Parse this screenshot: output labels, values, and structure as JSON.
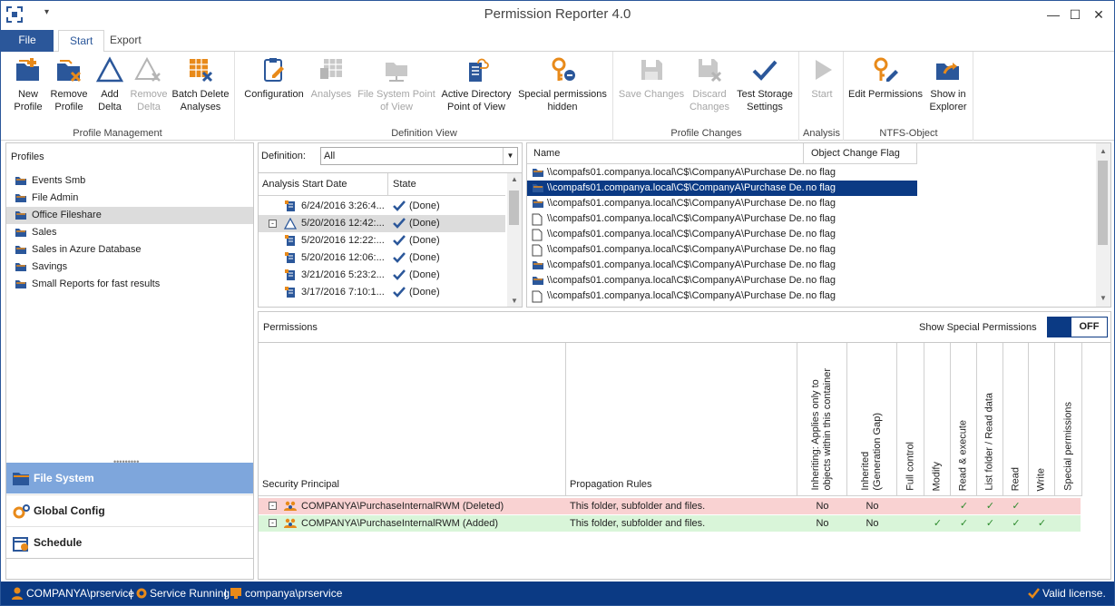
{
  "window": {
    "title": "Permission Reporter 4.0"
  },
  "colors": {
    "accent": "#2b579a",
    "selection": "#0b3a84",
    "nav_active": "#7ea6dc",
    "deleted_row": "#f9d2d2",
    "added_row": "#d9f5d9",
    "check": "#2e8b2e"
  },
  "ribbon_tabs": {
    "file": "File",
    "start": "Start",
    "export": "Export"
  },
  "ribbon": {
    "profile_management": {
      "label": "Profile Management",
      "new_profile": [
        "New",
        "Profile"
      ],
      "remove_profile": [
        "Remove",
        "Profile"
      ],
      "add_delta": [
        "Add",
        "Delta"
      ],
      "remove_delta": [
        "Remove",
        "Delta"
      ],
      "batch_delete": [
        "Batch Delete",
        "Analyses"
      ]
    },
    "definition_view": {
      "label": "Definition View",
      "configuration": "Configuration",
      "analyses": "Analyses",
      "file_system_pov": [
        "File System Point",
        "of View"
      ],
      "active_directory_pov": [
        "Active Directory",
        "Point of View"
      ],
      "special_permissions": [
        "Special permissions",
        "hidden"
      ]
    },
    "profile_changes": {
      "label": "Profile Changes",
      "save_changes": "Save Changes",
      "discard_changes": [
        "Discard",
        "Changes"
      ],
      "test_storage": [
        "Test Storage",
        "Settings"
      ]
    },
    "analysis": {
      "label": "Analysis",
      "start": "Start"
    },
    "ntfs_object": {
      "label": "NTFS-Object",
      "edit_permissions": "Edit Permissions",
      "show_in_explorer": [
        "Show in",
        "Explorer"
      ]
    }
  },
  "profiles": {
    "title": "Profiles",
    "items": [
      "Events Smb",
      "File Admin",
      "Office Fileshare",
      "Sales",
      "Sales in Azure Database",
      "Savings",
      "Small Reports for fast results"
    ],
    "selected": "Office Fileshare"
  },
  "nav": {
    "file_system": "File System",
    "global_config": "Global Config",
    "schedule": "Schedule"
  },
  "definition": {
    "label": "Definition:",
    "value": "All"
  },
  "analyses_grid": {
    "col_date": "Analysis Start Date",
    "col_state": "State",
    "rows": [
      {
        "date": "6/24/2016 3:26:4...",
        "state": "(Done)"
      },
      {
        "date": "5/20/2016 12:42:...",
        "state": "(Done)"
      },
      {
        "date": "5/20/2016 12:22:...",
        "state": "(Done)"
      },
      {
        "date": "5/20/2016 12:06:...",
        "state": "(Done)"
      },
      {
        "date": "3/21/2016 5:23:2...",
        "state": "(Done)"
      },
      {
        "date": "3/17/2016 7:10:1...",
        "state": "(Done)"
      }
    ]
  },
  "objects_grid": {
    "col_name": "Name",
    "col_flag": "Object Change Flag",
    "rows": [
      {
        "name": "\\\\compafs01.companya.local\\C$\\CompanyA\\Purchase De...",
        "flag": "no flag",
        "icon": "folder-icon"
      },
      {
        "name": "\\\\compafs01.companya.local\\C$\\CompanyA\\Purchase De...",
        "flag": "no flag",
        "icon": "folder-icon"
      },
      {
        "name": "\\\\compafs01.companya.local\\C$\\CompanyA\\Purchase De...",
        "flag": "no flag",
        "icon": "folder-icon"
      },
      {
        "name": "\\\\compafs01.companya.local\\C$\\CompanyA\\Purchase De...",
        "flag": "no flag",
        "icon": "file-icon"
      },
      {
        "name": "\\\\compafs01.companya.local\\C$\\CompanyA\\Purchase De...",
        "flag": "no flag",
        "icon": "file-icon"
      },
      {
        "name": "\\\\compafs01.companya.local\\C$\\CompanyA\\Purchase De...",
        "flag": "no flag",
        "icon": "file-icon"
      },
      {
        "name": "\\\\compafs01.companya.local\\C$\\CompanyA\\Purchase De...",
        "flag": "no flag",
        "icon": "folder-icon"
      },
      {
        "name": "\\\\compafs01.companya.local\\C$\\CompanyA\\Purchase De...",
        "flag": "no flag",
        "icon": "folder-icon"
      },
      {
        "name": "\\\\compafs01.companya.local\\C$\\CompanyA\\Purchase De...",
        "flag": "no flag",
        "icon": "file-icon"
      }
    ]
  },
  "permissions": {
    "title": "Permissions",
    "show_special_label": "Show Special Permissions",
    "toggle_state": "OFF",
    "columns": {
      "principal": "Security Principal",
      "propagation": "Propagation Rules",
      "inheriting": [
        "Inheriting: Applies only to",
        "objects within this container"
      ],
      "inherited": [
        "Inherited",
        "(Generation Gap)"
      ],
      "full_control": "Full control",
      "modify": "Modify",
      "read_execute": "Read & execute",
      "list_folder": "List folder / Read data",
      "read": "Read",
      "write": "Write",
      "special": "Special permissions"
    },
    "rows": [
      {
        "principal": "COMPANYA\\PurchaseInternalRWM (Deleted)",
        "propagation": "This folder, subfolder and files.",
        "inheriting": "No",
        "inherited": "No",
        "full_control": "",
        "modify": "",
        "read_execute": "✓",
        "list_folder": "✓",
        "read": "✓",
        "write": "",
        "special": ""
      },
      {
        "principal": "COMPANYA\\PurchaseInternalRWM (Added)",
        "propagation": "This folder, subfolder and files.",
        "inheriting": "No",
        "inherited": "No",
        "full_control": "",
        "modify": "✓",
        "read_execute": "✓",
        "list_folder": "✓",
        "read": "✓",
        "write": "✓",
        "special": ""
      }
    ]
  },
  "status": {
    "user": "COMPANYA\\prservice",
    "service": "Service Running",
    "account": "companya\\prservice",
    "license": "Valid license."
  }
}
